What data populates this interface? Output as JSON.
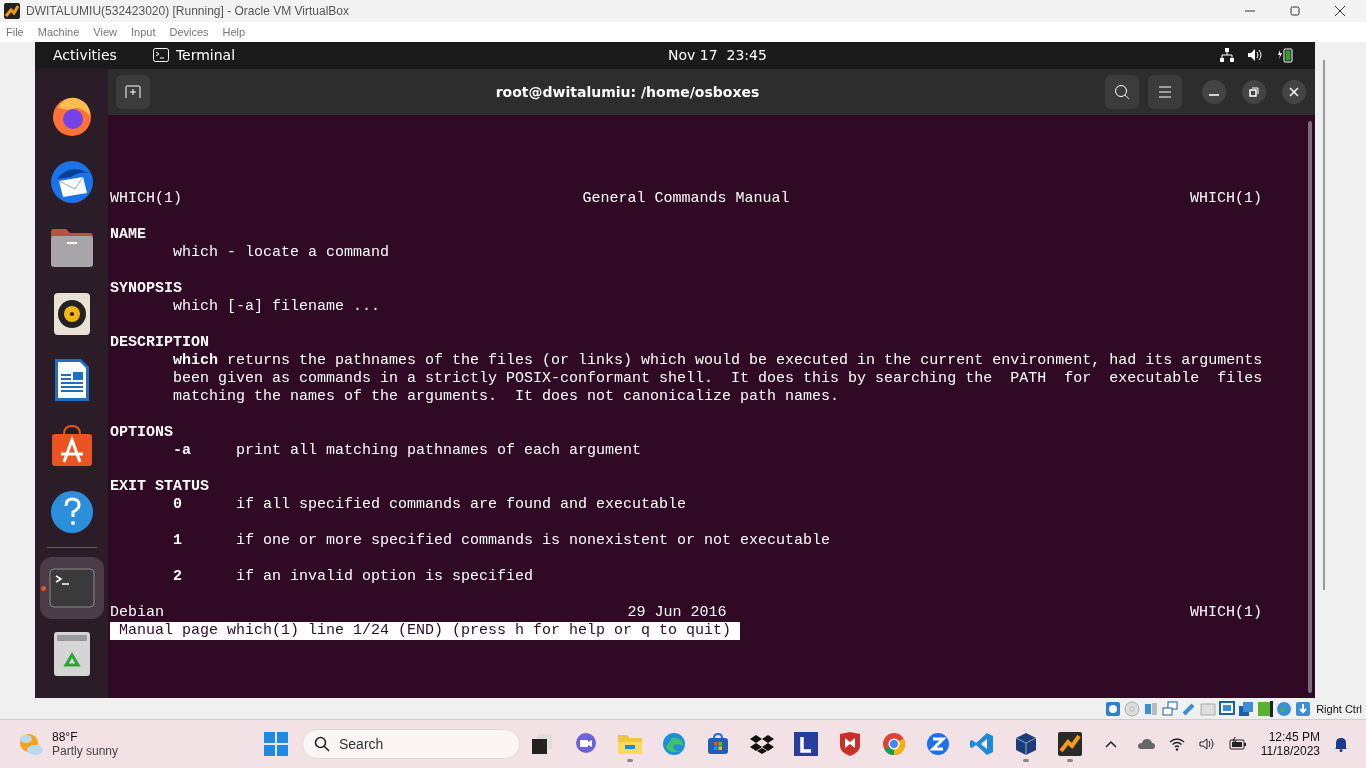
{
  "vbox_window": {
    "title": "DWITALUMIU(532423020) [Running] - Oracle VM VirtualBox",
    "menu": [
      "File",
      "Machine",
      "View",
      "Input",
      "Devices",
      "Help"
    ],
    "host_key": "Right Ctrl"
  },
  "topbar": {
    "activities": "Activities",
    "app": "Terminal",
    "clock": "Nov 17  23:45"
  },
  "dock": [
    {
      "kind": "firefox",
      "selected": false
    },
    {
      "kind": "mail",
      "selected": false
    },
    {
      "kind": "files",
      "selected": false
    },
    {
      "kind": "music",
      "selected": false
    },
    {
      "kind": "writer",
      "selected": false
    },
    {
      "kind": "software",
      "selected": false
    },
    {
      "kind": "help",
      "selected": false
    },
    {
      "kind": "terminal",
      "selected": true
    },
    {
      "kind": "trash",
      "selected": false
    }
  ],
  "terminal": {
    "title": "root@dwitalumiu: /home/osboxes",
    "header": [
      "WHICH(1)",
      "General Commands Manual",
      "WHICH(1)"
    ],
    "sections": [
      {
        "heading": "NAME",
        "paragraphs": [
          {
            "kind": "text",
            "lines": [
              "which - locate a command"
            ]
          }
        ]
      },
      {
        "heading": "SYNOPSIS",
        "paragraphs": [
          {
            "kind": "text",
            "lines": [
              "which [-a] filename ..."
            ]
          }
        ]
      },
      {
        "heading": "DESCRIPTION",
        "paragraphs": [
          {
            "kind": "text",
            "lines": [
              "**which** returns the pathnames of the files (or links) which would be executed in the current environment, had its arguments",
              "been given as commands in a strictly POSIX-conformant shell.  It does this by searching the  PATH  for  executable  files",
              "matching the names of the arguments.  It does not canonicalize path names."
            ]
          }
        ]
      },
      {
        "heading": "OPTIONS",
        "paragraphs": [
          {
            "kind": "option",
            "flag": "-a",
            "text": "print all matching pathnames of each argument"
          }
        ]
      },
      {
        "heading": "EXIT STATUS",
        "paragraphs": [
          {
            "kind": "option",
            "flag": "0",
            "text": "if all specified commands are found and executable"
          },
          {
            "kind": "option",
            "flag": "1",
            "text": "if one or more specified commands is nonexistent or not executable"
          },
          {
            "kind": "option",
            "flag": "2",
            "text": "if an invalid option is specified"
          }
        ]
      }
    ],
    "footer": [
      "Debian",
      "29 Jun 2016",
      "WHICH(1)"
    ],
    "status": "Manual page which(1) line 1/24 (END) (press h for help or q to quit)"
  },
  "taskbar": {
    "weather_temp": "88°F",
    "weather_text": "Partly sunny",
    "search_placeholder": "Search",
    "apps": [
      {
        "kind": "taskview",
        "running": false
      },
      {
        "kind": "meet",
        "running": false
      },
      {
        "kind": "explorer",
        "running": true
      },
      {
        "kind": "edge",
        "running": false
      },
      {
        "kind": "store",
        "running": false
      },
      {
        "kind": "dropbox",
        "running": false
      },
      {
        "kind": "letter-app",
        "running": false
      },
      {
        "kind": "shield",
        "running": false
      },
      {
        "kind": "chrome",
        "running": false
      },
      {
        "kind": "zoom",
        "running": false
      },
      {
        "kind": "vscode",
        "running": false
      },
      {
        "kind": "virtualbox",
        "running": true
      },
      {
        "kind": "vm",
        "running": true
      }
    ],
    "time": "12:45 PM",
    "date": "11/18/2023"
  }
}
